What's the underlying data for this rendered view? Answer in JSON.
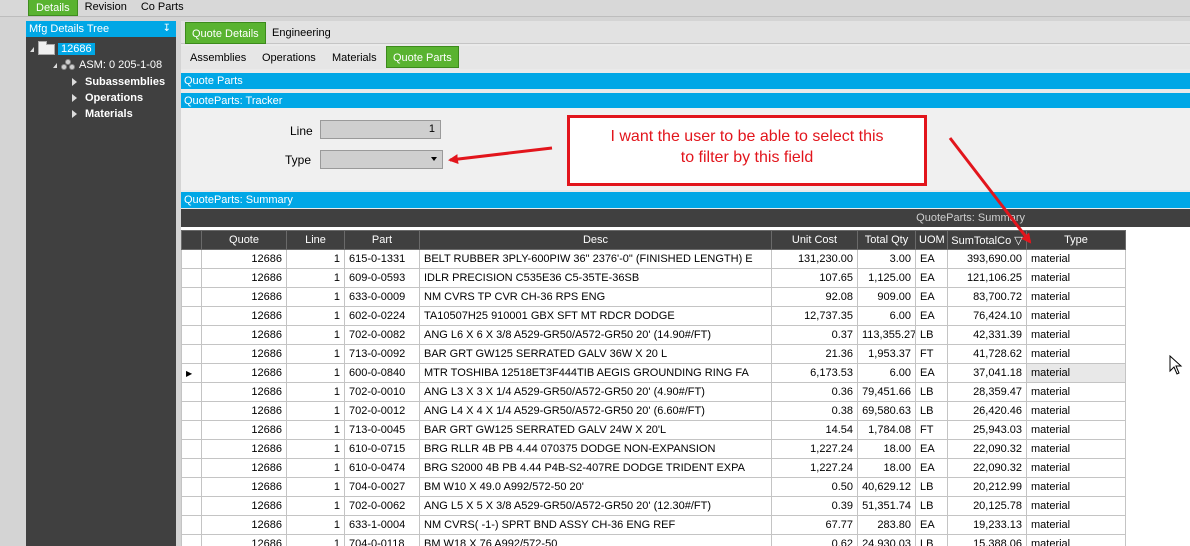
{
  "top_tabs": [
    "Details",
    "Revision",
    "Co Parts"
  ],
  "tree": {
    "title": "Mfg Details Tree",
    "root": "12686",
    "asm": "ASM: 0 205-1-08",
    "children": [
      "Subassemblies",
      "Operations",
      "Materials"
    ]
  },
  "tabs1": [
    "Quote Details",
    "Engineering"
  ],
  "tabs2": [
    "Assemblies",
    "Operations",
    "Materials",
    "Quote Parts"
  ],
  "sections": {
    "quote_parts": "Quote Parts",
    "tracker": "QuoteParts: Tracker",
    "summary": "QuoteParts: Summary",
    "grid_caption": "QuoteParts: Summary"
  },
  "tracker": {
    "line_label": "Line",
    "line_value": "1",
    "type_label": "Type",
    "type_value": ""
  },
  "callout": {
    "line1": "I want the user to be able to select this",
    "line2": "to filter by this field"
  },
  "colors": {
    "accent_blue": "#00a7e6",
    "active_green": "#59b330",
    "dark_panel": "#404040",
    "annotation_red": "#e2151c"
  },
  "grid": {
    "columns": [
      "Quote",
      "Line",
      "Part",
      "Desc",
      "Unit Cost",
      "Total Qty",
      "UOM",
      "SumTotalCo",
      "Type"
    ],
    "rows": [
      [
        "12686",
        "1",
        "615-0-1331",
        "BELT RUBBER 3PLY-600PIW 36\" 2376'-0\" (FINISHED LENGTH) E",
        "131,230.00",
        "3.00",
        "EA",
        "393,690.00",
        "material"
      ],
      [
        "12686",
        "1",
        "609-0-0593",
        "IDLR PRECISION  C535E36  C5-35TE-36SB",
        "107.65",
        "1,125.00",
        "EA",
        "121,106.25",
        "material"
      ],
      [
        "12686",
        "1",
        "633-0-0009",
        "NM CVRS TP CVR CH-36 RPS ENG",
        "92.08",
        "909.00",
        "EA",
        "83,700.72",
        "material"
      ],
      [
        "12686",
        "1",
        "602-0-0224",
        "TA10507H25 910001 GBX SFT MT RDCR DODGE",
        "12,737.35",
        "6.00",
        "EA",
        "76,424.10",
        "material"
      ],
      [
        "12686",
        "1",
        "702-0-0082",
        "ANG L6 X 6 X 3/8 A529-GR50/A572-GR50 20' (14.90#/FT)",
        "0.37",
        "113,355.27",
        "LB",
        "42,331.39",
        "material"
      ],
      [
        "12686",
        "1",
        "713-0-0092",
        "BAR GRT GW125 SERRATED GALV 36W X 20 L",
        "21.36",
        "1,953.37",
        "FT",
        "41,728.62",
        "material"
      ],
      [
        "12686",
        "1",
        "600-0-0840",
        "MTR TOSHIBA 12518ET3F444TIB AEGIS GROUNDING RING FA",
        "6,173.53",
        "6.00",
        "EA",
        "37,041.18",
        "material"
      ],
      [
        "12686",
        "1",
        "702-0-0010",
        "ANG L3 X 3 X 1/4 A529-GR50/A572-GR50 20' (4.90#/FT)",
        "0.36",
        "79,451.66",
        "LB",
        "28,359.47",
        "material"
      ],
      [
        "12686",
        "1",
        "702-0-0012",
        "ANG L4 X 4 X 1/4 A529-GR50/A572-GR50 20' (6.60#/FT)",
        "0.38",
        "69,580.63",
        "LB",
        "26,420.46",
        "material"
      ],
      [
        "12686",
        "1",
        "713-0-0045",
        "BAR GRT GW125 SERRATED GALV 24W X 20'L",
        "14.54",
        "1,784.08",
        "FT",
        "25,943.03",
        "material"
      ],
      [
        "12686",
        "1",
        "610-0-0715",
        "BRG RLLR 4B PB 4.44 070375 DODGE NON-EXPANSION",
        "1,227.24",
        "18.00",
        "EA",
        "22,090.32",
        "material"
      ],
      [
        "12686",
        "1",
        "610-0-0474",
        "BRG S2000 4B PB 4.44 P4B-S2-407RE DODGE   TRIDENT EXPA",
        "1,227.24",
        "18.00",
        "EA",
        "22,090.32",
        "material"
      ],
      [
        "12686",
        "1",
        "704-0-0027",
        "BM W10 X 49.0 A992/572-50 20'",
        "0.50",
        "40,629.12",
        "LB",
        "20,212.99",
        "material"
      ],
      [
        "12686",
        "1",
        "702-0-0062",
        "ANG L5 X 5 X 3/8 A529-GR50/A572-GR50 20' (12.30#/FT)",
        "0.39",
        "51,351.74",
        "LB",
        "20,125.78",
        "material"
      ],
      [
        "12686",
        "1",
        "633-1-0004",
        "NM CVRS( -1-) SPRT BND ASSY CH-36 ENG REF",
        "67.77",
        "283.80",
        "EA",
        "19,233.13",
        "material"
      ],
      [
        "12686",
        "1",
        "704-0-0118",
        "BM W18 X 76 A992/572-50",
        "0.62",
        "24,930.03",
        "LB",
        "15,388.06",
        "material"
      ]
    ]
  }
}
